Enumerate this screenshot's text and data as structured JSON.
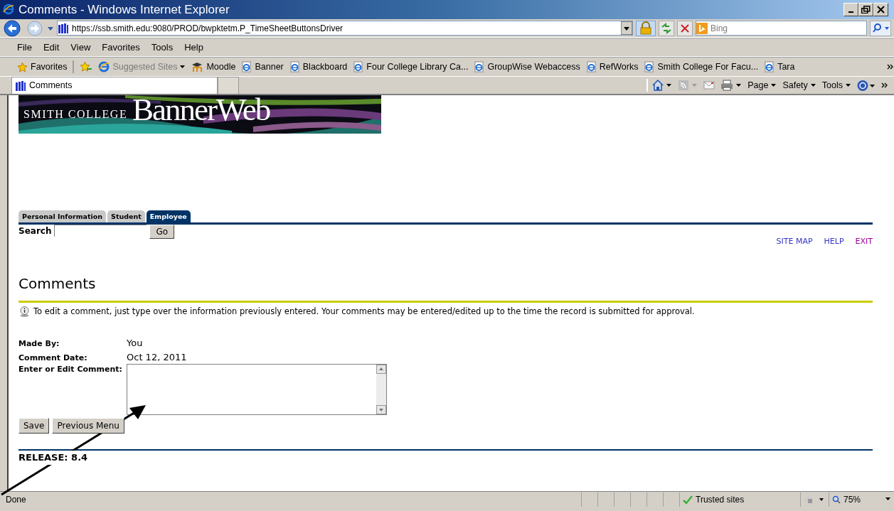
{
  "window": {
    "title": "Comments - Windows Internet Explorer"
  },
  "address_bar": {
    "url": "https://ssb.smith.edu:9080/PROD/bwpktetm.P_TimeSheetButtonsDriver",
    "search_placeholder": "Bing"
  },
  "menu": [
    "File",
    "Edit",
    "View",
    "Favorites",
    "Tools",
    "Help"
  ],
  "favorites_bar": {
    "label": "Favorites",
    "items": [
      {
        "kind": "suggested",
        "label": "Suggested Sites"
      },
      {
        "kind": "moodle",
        "label": "Moodle"
      },
      {
        "kind": "page",
        "label": "Banner"
      },
      {
        "kind": "page",
        "label": "Blackboard"
      },
      {
        "kind": "page",
        "label": "Four College Library Ca..."
      },
      {
        "kind": "page",
        "label": "GroupWise Webaccess"
      },
      {
        "kind": "page",
        "label": "RefWorks"
      },
      {
        "kind": "page",
        "label": "Smith College For Facu..."
      },
      {
        "kind": "page",
        "label": "Tara"
      }
    ]
  },
  "browser_tab": {
    "title": "Comments"
  },
  "command_bar": [
    "Page",
    "Safety",
    "Tools"
  ],
  "page": {
    "logo": {
      "college": "SMITH COLLEGE",
      "product": "BannerWeb"
    },
    "tabs": [
      {
        "label": "Personal Information",
        "selected": false
      },
      {
        "label": "Student",
        "selected": false
      },
      {
        "label": "Employee",
        "selected": true
      }
    ],
    "search": {
      "label": "Search",
      "button": "Go"
    },
    "links": [
      {
        "label": "SITE MAP",
        "visited": false
      },
      {
        "label": "HELP",
        "visited": false
      },
      {
        "label": "EXIT",
        "visited": true
      }
    ],
    "heading": "Comments",
    "info": "To edit a comment, just type over the information previously entered. Your comments may be entered/edited up to the time the record is submitted for approval.",
    "fields": [
      {
        "label": "Made By:",
        "value": "You"
      },
      {
        "label": "Comment Date:",
        "value": "Oct 12, 2011"
      }
    ],
    "comment_label": "Enter or Edit Comment:",
    "buttons": [
      "Save",
      "Previous Menu"
    ],
    "release": "RELEASE: 8.4"
  },
  "status_bar": {
    "text": "Done",
    "zone": "Trusted sites",
    "zoom": "75%"
  }
}
